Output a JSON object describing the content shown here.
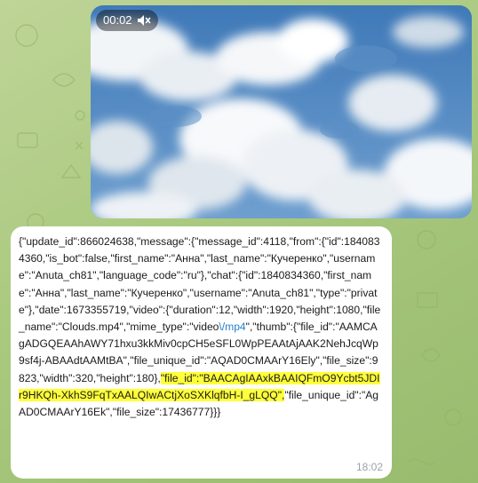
{
  "video": {
    "duration": "00:02",
    "mute_icon": "speaker-muted-icon"
  },
  "message": {
    "text_before_link": "{\"update_id\":866024638,\"message\":{\"message_id\":4118,\"from\":{\"id\":1840834360,\"is_bot\":false,\"first_name\":\"Анна\",\"last_name\":\"Кучеренко\",\"username\":\"Anuta_ch81\",\"language_code\":\"ru\"},\"chat\":{\"id\":1840834360,\"first_name\":\"Анна\",\"last_name\":\"Кучеренко\",\"username\":\"Anuta_ch81\",\"type\":\"private\"},\"date\":1673355719,\"video\":{\"duration\":12,\"width\":1920,\"height\":1080,\"file_name\":\"Clouds.mp4\",\"mime_type\":\"video",
    "link": "\\/mp4",
    "text_after_link": "\",\"thumb\":{\"file_id\":\"AAMCAgADGQEAAhAWY71hxu3kkMiv0cpCH5eSFL0WpPEAAtAjAAK2NehJcqWp9sf4j-ABAAdtAAMtBA\",\"file_unique_id\":\"AQAD0CMAArY16Ely\",\"file_size\":9823,\"width\":320,\"height\":180},",
    "highlighted": "\"file_id\":\"BAACAgIAAxkBAAIQFmO9Ycbt5JDIr9HKQh-XkhS9FqTxAALQIwACtjXoSXKlqfbH-I_gLQQ\",",
    "text_end": "\"file_unique_id\":\"AgAD0CMAArY16Ek\",\"file_size\":17436777}}}",
    "time": "18:02"
  }
}
